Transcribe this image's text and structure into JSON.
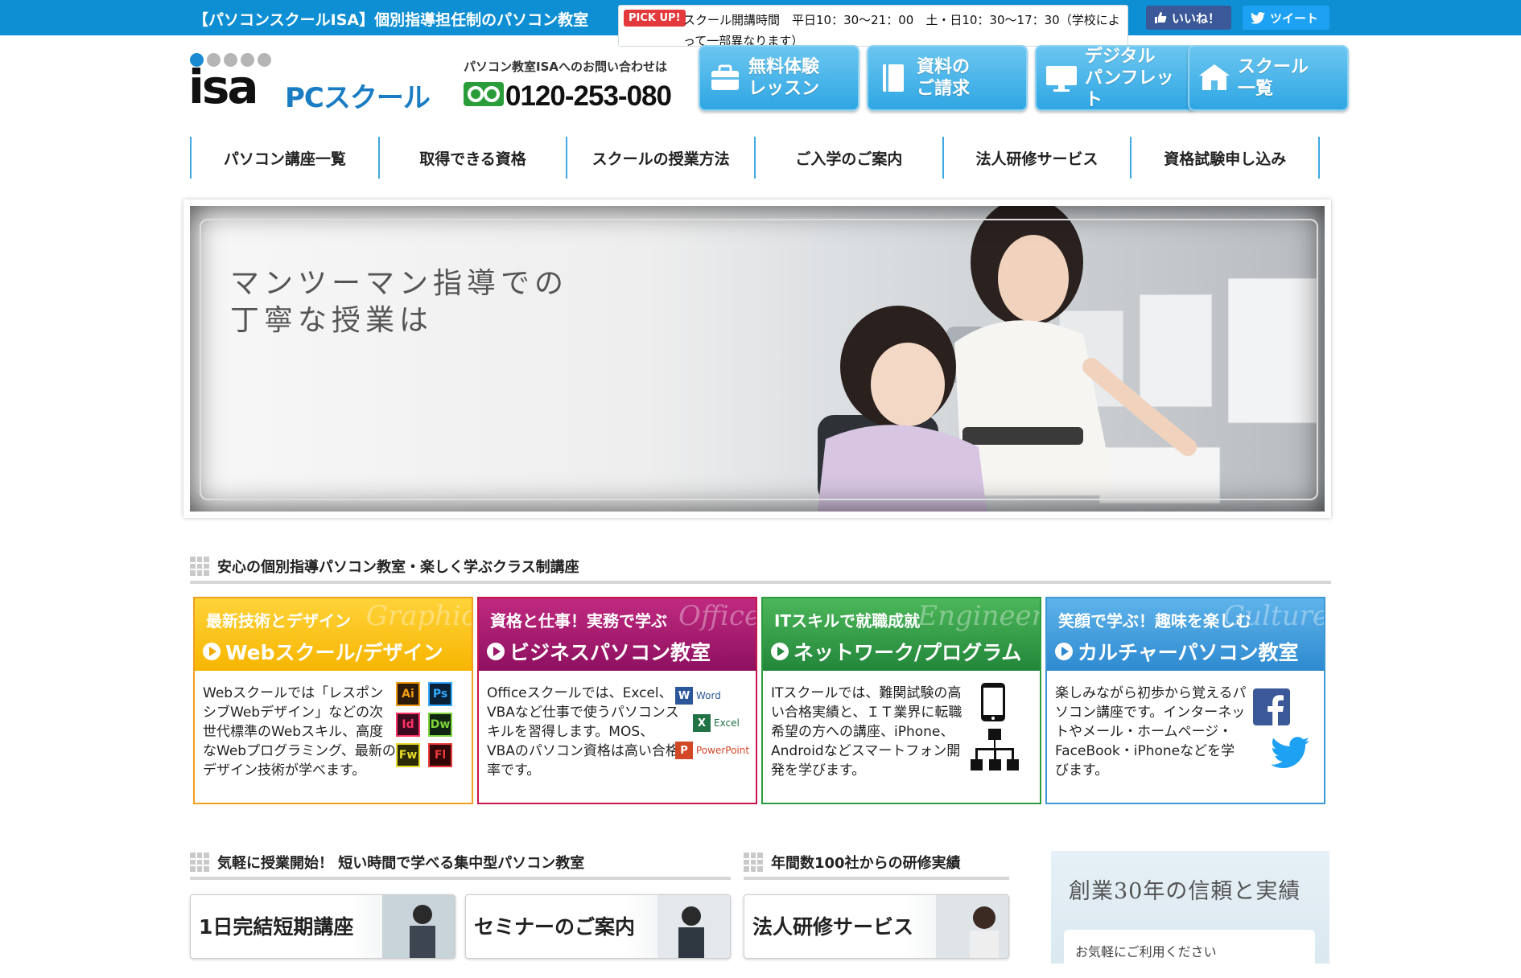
{
  "topbar": {
    "title": "【パソコンスクールISA】個別指導担任制のパソコン教室",
    "pickup_badge": "PICK UP!",
    "pickup_text": "スクール開講時間　平日10：30〜21：00　土・日10：30〜17：30（学校によって一部異なります）",
    "like_label": "いいね！",
    "tweet_label": "ツイート"
  },
  "header": {
    "logo_isa": "isa",
    "logo_pc": "PCスクール",
    "contact_label": "パソコン教室ISAへのお問い合わせは",
    "phone": "0120-253-080",
    "buttons": [
      {
        "label": "無料体験\nレッスン",
        "icon": "bag-icon"
      },
      {
        "label": "資料の\nご請求",
        "icon": "document-icon"
      },
      {
        "label": "デジタル\nパンフレット",
        "icon": "monitor-icon"
      },
      {
        "label": "スクール\n一覧",
        "icon": "school-icon"
      }
    ]
  },
  "nav": [
    "パソコン講座一覧",
    "取得できる資格",
    "スクールの授業方法",
    "ご入学のご案内",
    "法人研修サービス",
    "資格試験申し込み"
  ],
  "hero": {
    "catch": "マンツーマン指導での\n丁寧な授業は"
  },
  "section1": {
    "title": "安心の個別指導パソコン教室・楽しく学ぶクラス制講座"
  },
  "cards": [
    {
      "sub": "最新技術とデザイン",
      "en": "Graphic",
      "main": "Webスクール/デザイン",
      "desc": "Webスクールでは「レスポンシブWebデザイン」などの次世代標準のWebスキル、高度なWebプログラミング、最新のデザイン技術が学べます。",
      "icons": [
        "Ai",
        "Ps",
        "Id",
        "Dw",
        "Fw",
        "Fl"
      ]
    },
    {
      "sub": "資格と仕事！実務で学ぶ",
      "en": "Office",
      "main": "ビジネスパソコン教室",
      "desc": "Officeスクールでは、Excel、VBAなど仕事で使うパソコンスキルを習得します。MOS、VBAのパソコン資格は高い合格率です。",
      "icons": [
        "Word",
        "Excel",
        "PowerPoint"
      ]
    },
    {
      "sub": "ITスキルで就職成就",
      "en": "Engineer",
      "main": "ネットワーク/プログラム",
      "desc": "ITスクールでは、難関試験の高い合格実績と、ＩＴ業界に転職希望の方への講座、iPhone、Androidなどスマートフォン開発を学びます。",
      "icons": [
        "smartphone-icon",
        "network-icon"
      ]
    },
    {
      "sub": "笑顔で学ぶ！趣味を楽しむ",
      "en": "Culture",
      "main": "カルチャーパソコン教室",
      "desc": "楽しみながら初歩から覚えるパソコン講座です。インターネットやメール・ホームページ・FaceBook・iPhoneなどを学びます。",
      "icons": [
        "facebook-icon",
        "twitter-icon"
      ]
    }
  ],
  "section2": {
    "title": "気軽に授業開始！ 短い時間で学べる集中型パソコン教室"
  },
  "section3": {
    "title": "年間数100社からの研修実績"
  },
  "promos": [
    "1日完結短期講座",
    "セミナーのご案内",
    "法人研修サービス"
  ],
  "side": {
    "title": "創業30年の信頼と実績",
    "note": "お気軽にご利用ください"
  },
  "colors": {
    "brand": "#0e8fd3",
    "web": "#f7b500",
    "business": "#8e1060",
    "network": "#23863a",
    "culture": "#2e8ad0"
  }
}
